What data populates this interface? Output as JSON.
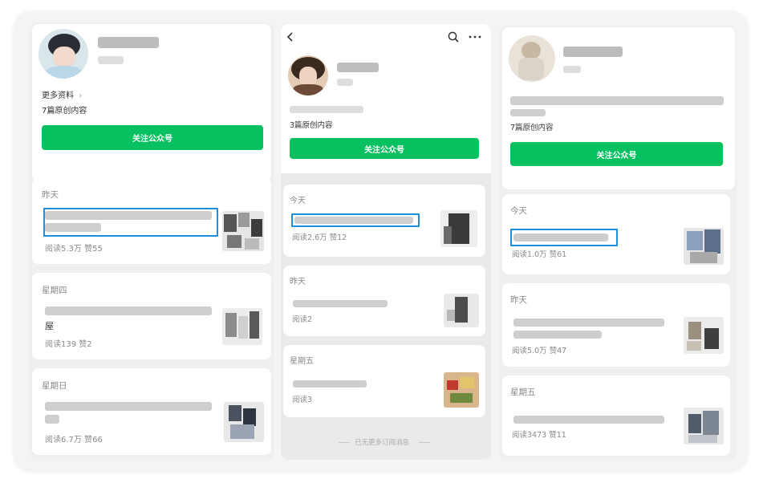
{
  "left": {
    "more_info": "更多资料",
    "more_chevron": "›",
    "original_count": "7篇原创内容",
    "follow_label": "关注公众号",
    "articles": [
      {
        "day": "昨天",
        "stats": "阅读5.3万  赞55",
        "title_tail": ""
      },
      {
        "day": "星期四",
        "stats": "阅读139  赞2",
        "title_tail": "屋"
      },
      {
        "day": "星期日",
        "stats": "阅读6.7万  赞66",
        "title_tail": ""
      }
    ]
  },
  "middle": {
    "back_icon": "chevron-left-icon",
    "search_icon": "search-icon",
    "more_icon": "more-dots-icon",
    "original_count": "3篇原创内容",
    "follow_label": "关注公众号",
    "articles": [
      {
        "day": "今天",
        "stats": "阅读2.6万  赞12"
      },
      {
        "day": "昨天",
        "stats": "阅读2"
      },
      {
        "day": "星期五",
        "stats": "阅读3"
      }
    ],
    "footer": "已无更多订阅消息"
  },
  "right": {
    "original_count": "7篇原创内容",
    "follow_label": "关注公众号",
    "articles": [
      {
        "day": "今天",
        "stats": "阅读1.0万  赞61"
      },
      {
        "day": "昨天",
        "stats": "阅读5.0万  赞47"
      },
      {
        "day": "星期五",
        "stats": "阅读3473  赞11"
      }
    ]
  },
  "colors": {
    "brand_green": "#07c160",
    "highlight_blue": "#1a8fdc"
  }
}
